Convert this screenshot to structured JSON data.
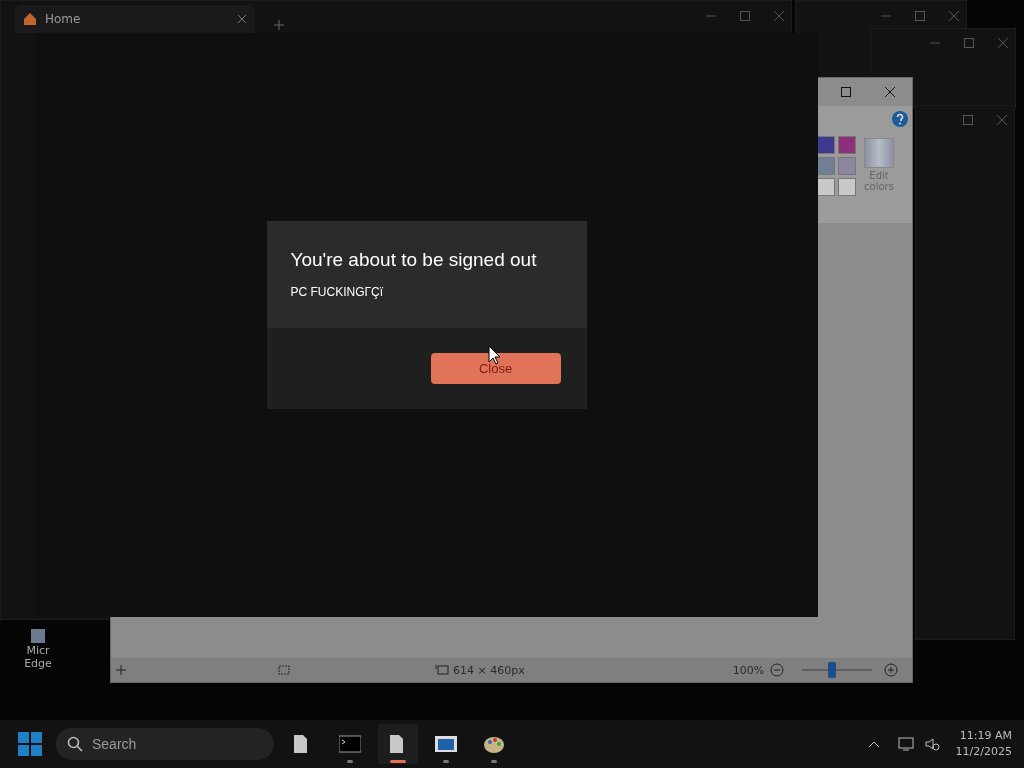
{
  "browser_window": {
    "tab_title": "Home"
  },
  "paint_window": {
    "swatches": [
      {
        "color": "#3c3a90"
      },
      {
        "color": "#8e2f7c"
      },
      {
        "color": "#6f8096"
      },
      {
        "color": "#8c86a0"
      },
      {
        "color": "#c9c9c9"
      },
      {
        "color": "#c9c9c9"
      }
    ],
    "edit_colors_label": "Edit colors",
    "status_bar": {
      "image_size": "614 × 460px",
      "zoom": "100%",
      "zoom_slider": {
        "level": 0.42
      }
    }
  },
  "desktop_icon": {
    "label_lines": [
      "Micr",
      "Edge"
    ]
  },
  "dialog": {
    "title": "You're about to be signed out",
    "message": "PC FUCKINGΓÇï",
    "button": "Close"
  },
  "taskbar": {
    "search": {
      "placeholder": "Search"
    },
    "apps": [
      {
        "kind": "file",
        "running": false,
        "active": false
      },
      {
        "kind": "terminal",
        "running": true,
        "active": false
      },
      {
        "kind": "notepad",
        "running": true,
        "active": true
      },
      {
        "kind": "window",
        "running": true,
        "active": false
      },
      {
        "kind": "paint",
        "running": true,
        "active": false
      }
    ],
    "time": "11:19 AM",
    "date": "11/2/2025"
  }
}
